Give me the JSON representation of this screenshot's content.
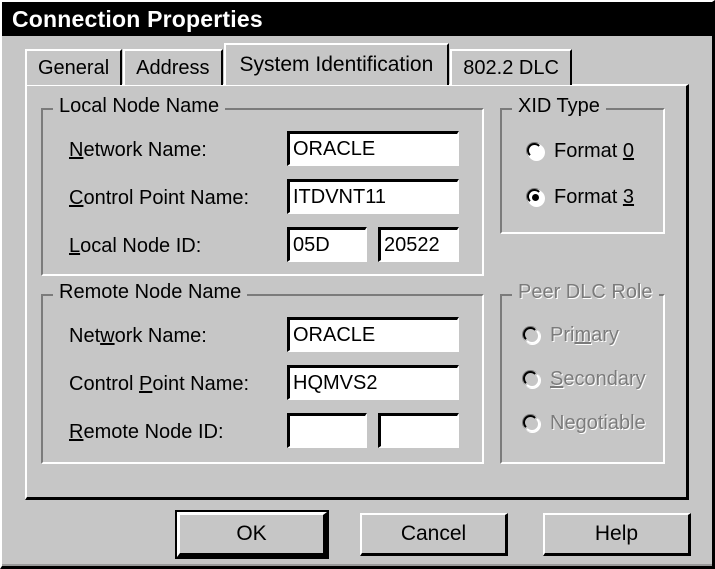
{
  "window": {
    "title": "Connection Properties"
  },
  "tabs": [
    {
      "label": "General",
      "selected": false
    },
    {
      "label": "Address",
      "selected": false
    },
    {
      "label": "System Identification",
      "selected": true
    },
    {
      "label": "802.2 DLC",
      "selected": false
    }
  ],
  "local_node": {
    "group_title": "Local Node Name",
    "network_name_label_pre": "",
    "network_name_label_accel": "N",
    "network_name_label_post": "etwork Name:",
    "network_name_value": "ORACLE",
    "control_point_label_accel": "C",
    "control_point_label_post": "ontrol Point Name:",
    "control_point_value": "ITDVNT11",
    "node_id_label_accel": "L",
    "node_id_label_post": "ocal Node ID:",
    "node_id_value_1": "05D",
    "node_id_value_2": "20522"
  },
  "remote_node": {
    "group_title": "Remote Node Name",
    "network_name_label_pre": "Net",
    "network_name_label_accel": "w",
    "network_name_label_post": "ork Name:",
    "network_name_value": "ORACLE",
    "control_point_label_pre": "Control ",
    "control_point_label_accel": "P",
    "control_point_label_post": "oint Name:",
    "control_point_value": "HQMVS2",
    "node_id_label_accel": "R",
    "node_id_label_post": "emote Node ID:",
    "node_id_value_1": "",
    "node_id_value_2": ""
  },
  "xid_type": {
    "group_title": "XID Type",
    "options": [
      {
        "label_pre": "Format ",
        "label_accel": "0",
        "selected": false
      },
      {
        "label_pre": "Format ",
        "label_accel": "3",
        "selected": true
      }
    ]
  },
  "peer_dlc_role": {
    "group_title": "Peer DLC Role",
    "disabled": true,
    "options": [
      {
        "label_pre": "Pri",
        "label_accel": "m",
        "label_post": "ary",
        "selected": false
      },
      {
        "label_pre": "",
        "label_accel": "S",
        "label_post": "econdary",
        "selected": false
      },
      {
        "label_pre": "Ne",
        "label_accel": "g",
        "label_post": "otiable",
        "selected": false
      }
    ]
  },
  "buttons": {
    "ok": "OK",
    "cancel": "Cancel",
    "help": "Help"
  },
  "colors": {
    "face": "#c6c6c6",
    "shadow": "#7b7b7b",
    "highlight": "#ffffff",
    "dark": "#000000",
    "titlebar_bg": "#000000",
    "titlebar_fg": "#ffffff"
  }
}
